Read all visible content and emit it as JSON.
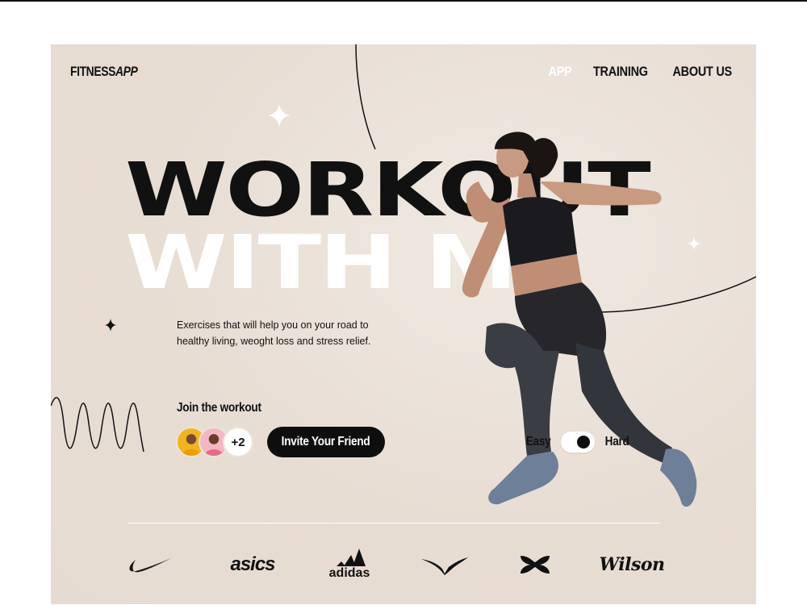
{
  "header": {
    "logo": {
      "part1": "FITNESS",
      "part2": "APP"
    },
    "nav": [
      {
        "label": "APP",
        "active": true
      },
      {
        "label": "TRAINING",
        "active": false
      },
      {
        "label": "ABOUT US",
        "active": false
      }
    ]
  },
  "hero": {
    "title_line1": "WORKOUT",
    "title_line2": "WITH ME",
    "description": "Exercises that will help you on your road to healthy living, weoght loss and stress relief."
  },
  "join": {
    "label": "Join the workout",
    "extra_count": "+2",
    "invite_button": "Invite Your Friend"
  },
  "difficulty": {
    "easy_label": "Easy",
    "hard_label": "Hard",
    "selected": "Hard"
  },
  "brands": [
    {
      "name": "nike",
      "text": ""
    },
    {
      "name": "asics",
      "text": "asics"
    },
    {
      "name": "adidas",
      "text": "adidas"
    },
    {
      "name": "mizuno",
      "text": ""
    },
    {
      "name": "under-armour",
      "text": ""
    },
    {
      "name": "wilson",
      "text": "Wilson"
    }
  ],
  "colors": {
    "background": "#e8ddd3",
    "text": "#111111",
    "button": "#0e0e0e",
    "active_nav": "#ffffff"
  },
  "icons": [
    "sparkle-icon",
    "sparkle-small-icon",
    "wave-icon",
    "orbit-arc"
  ]
}
